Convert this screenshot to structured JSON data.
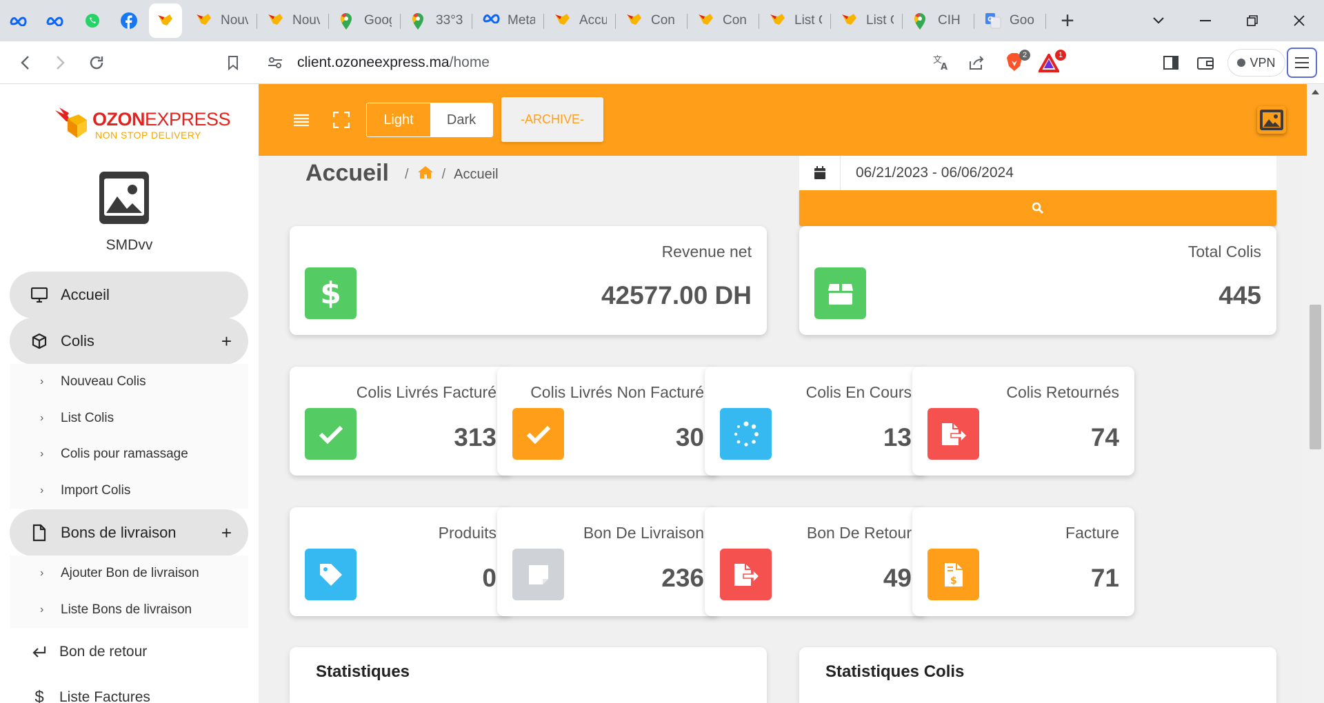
{
  "browser": {
    "pinned_tabs": [
      "meta-icon",
      "meta-icon",
      "whatsapp-icon",
      "facebook-icon",
      "ozon-icon"
    ],
    "tabs": [
      {
        "title": "Nouv",
        "icon": "ozon-icon"
      },
      {
        "title": "Nouv",
        "icon": "ozon-icon"
      },
      {
        "title": "Goog",
        "icon": "maps-icon"
      },
      {
        "title": "33°3",
        "icon": "maps-icon"
      },
      {
        "title": "Meta",
        "icon": "meta-icon"
      },
      {
        "title": "Accu",
        "icon": "ozon-icon"
      },
      {
        "title": "Con",
        "icon": "ozon-icon"
      },
      {
        "title": "Con",
        "icon": "ozon-icon"
      },
      {
        "title": "List C",
        "icon": "ozon-icon"
      },
      {
        "title": "List C",
        "icon": "ozon-icon"
      },
      {
        "title": "CIH",
        "icon": "maps-icon"
      },
      {
        "title": "Goo",
        "icon": "translate-icon"
      }
    ],
    "new_tab": "+",
    "url_host": "client.ozoneexpress.ma",
    "url_path": "/home",
    "vpn_label": "VPN",
    "brave_badge": "2",
    "rewards_badge": "1"
  },
  "brand": {
    "name_part1": "OZON",
    "name_part2": "EXPRESS",
    "tagline": "NON STOP DELIVERY"
  },
  "sidebar": {
    "username": "SMDvv",
    "accueil": "Accueil",
    "colis": "Colis",
    "colis_items": [
      "Nouveau Colis",
      "List Colis",
      "Colis pour ramassage",
      "Import Colis"
    ],
    "bons": "Bons de livraison",
    "bons_items": [
      "Ajouter Bon de livraison",
      "Liste Bons de livraison"
    ],
    "bon_retour": "Bon de retour",
    "factures": "Liste Factures",
    "plus": "+"
  },
  "topbar": {
    "light": "Light",
    "dark": "Dark",
    "archive": "-ARCHIVE-"
  },
  "header": {
    "title": "Accueil",
    "crumb_sep": "/",
    "crumb_current": "Accueil",
    "date_range": "06/21/2023 - 06/06/2024"
  },
  "stats": {
    "revenue_label": "Revenue net",
    "revenue_value": "42577.00 DH",
    "total_label": "Total Colis",
    "total_value": "445",
    "cards": [
      {
        "label": "Colis Livrés Facturé",
        "value": "313",
        "icon": "check-icon",
        "color": "#55cb63"
      },
      {
        "label": "Colis Livrés Non Facturé",
        "value": "30",
        "icon": "check-icon",
        "color": "#ff9f19"
      },
      {
        "label": "Colis En Cours",
        "value": "13",
        "icon": "spinner-icon",
        "color": "#36b9f0"
      },
      {
        "label": "Colis Retournés",
        "value": "74",
        "icon": "file-export-icon",
        "color": "#f4514f"
      },
      {
        "label": "Produits",
        "value": "0",
        "icon": "tag-icon",
        "color": "#36b9f0"
      },
      {
        "label": "Bon De Livraison",
        "value": "236",
        "icon": "sticky-note-icon",
        "color": "#cfd3d8"
      },
      {
        "label": "Bon De Retour",
        "value": "49",
        "icon": "file-export-icon",
        "color": "#f4514f"
      },
      {
        "label": "Facture",
        "value": "71",
        "icon": "invoice-icon",
        "color": "#ff9f19"
      }
    ]
  },
  "panels": {
    "left": "Statistiques",
    "right": "Statistiques Colis"
  }
}
